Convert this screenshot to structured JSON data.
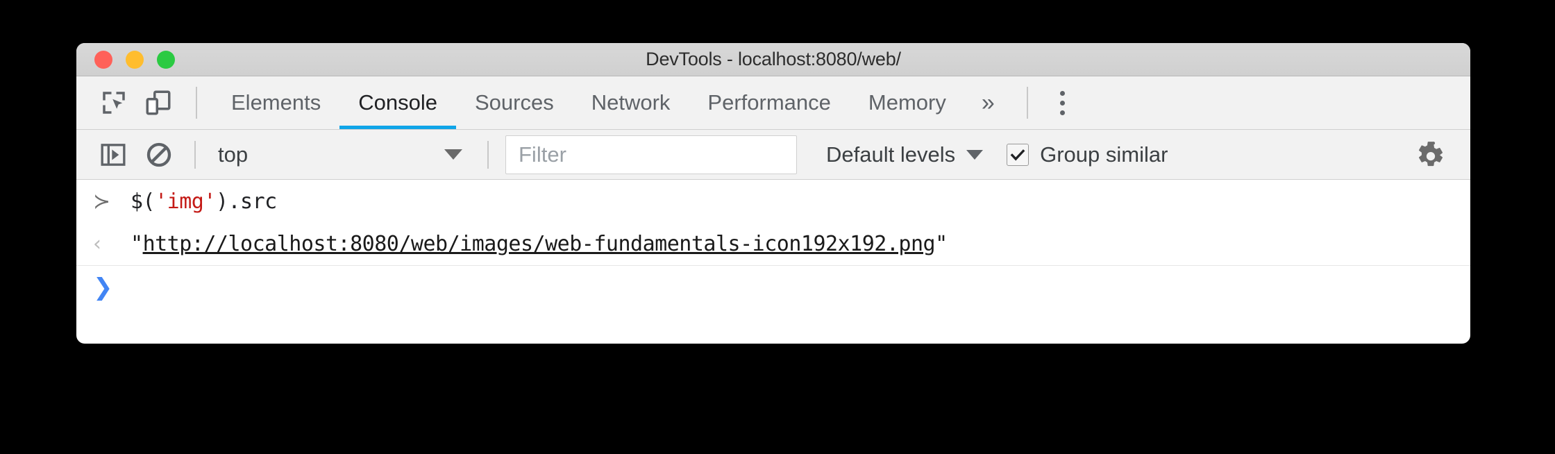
{
  "window": {
    "title": "DevTools - localhost:8080/web/",
    "traffic_lights": [
      {
        "name": "close",
        "color": "#ff6159"
      },
      {
        "name": "minimize",
        "color": "#ffbd2e"
      },
      {
        "name": "zoom",
        "color": "#2bca42"
      }
    ]
  },
  "tabbar": {
    "icons": [
      {
        "name": "inspect-element-icon",
        "title": "Inspect element"
      },
      {
        "name": "device-toolbar-icon",
        "title": "Toggle device toolbar"
      }
    ],
    "tabs": [
      {
        "label": "Elements",
        "active": false
      },
      {
        "label": "Console",
        "active": true
      },
      {
        "label": "Sources",
        "active": false
      },
      {
        "label": "Network",
        "active": false
      },
      {
        "label": "Performance",
        "active": false
      },
      {
        "label": "Memory",
        "active": false
      }
    ],
    "overflow_label": "»",
    "active_tab_underline_color": "#10a5e8",
    "menu_name": "more-options"
  },
  "console_toolbar": {
    "sidebar_toggle_name": "console-sidebar-toggle",
    "clear_console_name": "clear-console",
    "context": {
      "label": "top",
      "caret": "▼"
    },
    "filter": {
      "value": "",
      "placeholder": "Filter"
    },
    "levels": {
      "label": "Default levels",
      "caret": "▼"
    },
    "group_similar": {
      "label": "Group similar",
      "checked": true,
      "check_glyph": "✔"
    },
    "settings_name": "settings-gear"
  },
  "console": {
    "rows": [
      {
        "type": "input",
        "gutter": "≻",
        "code_before": "$(",
        "code_string": "'img'",
        "code_after": ").src"
      },
      {
        "type": "result",
        "gutter": "‹",
        "quote_open": "\"",
        "url": "http://localhost:8080/web/images/web-fundamentals-icon192x192.png",
        "quote_close": "\""
      },
      {
        "type": "prompt",
        "gutter": "❯",
        "value": ""
      }
    ]
  },
  "colors": {
    "accent_blue": "#10a5e8",
    "prompt_blue": "#4285f4",
    "string_red": "#c41a16",
    "toolbar_bg": "#f2f2f2",
    "titlebar_bg": "#d4d4d4",
    "page_bg": "#000000"
  }
}
